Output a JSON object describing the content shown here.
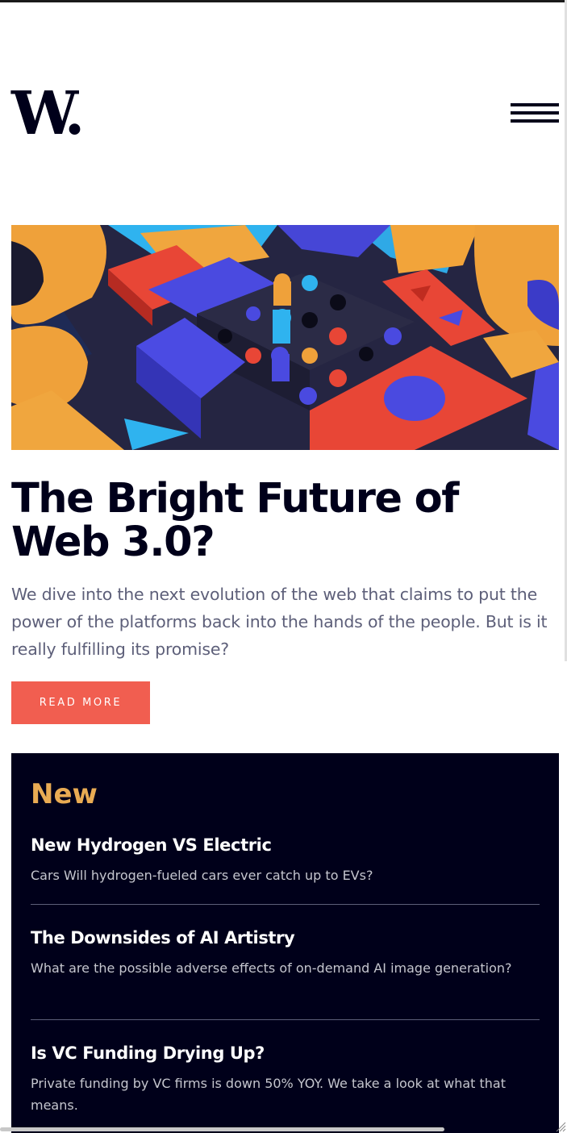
{
  "header": {
    "logo_text": "W.",
    "menu_icon": "hamburger-menu-icon"
  },
  "hero": {
    "image_icon": "abstract-blocks-illustration",
    "title": "The Bright Future of Web 3.0?",
    "description": "We dive into the next evolution of the web that claims to put the power of the platforms back into the hands of the people. But is it really fulfilling its promise?",
    "button_label": "READ MORE"
  },
  "new_section": {
    "heading": "New",
    "items": [
      {
        "title": "New Hydrogen VS Electric",
        "description": "Cars Will hydrogen-fueled cars ever catch up to EVs?"
      },
      {
        "title": "The Downsides of AI Artistry",
        "description": "What are the possible adverse effects of on-demand AI image generation?"
      },
      {
        "title": "Is VC Funding Drying Up?",
        "description": "Private funding by VC firms is down 50% YOY. We take a look at what that means."
      }
    ]
  },
  "colors": {
    "dark_navy": "#00001a",
    "accent_red": "#f15e50",
    "accent_orange": "#e9ab53",
    "grayish_blue": "#5d5f79",
    "light_gray_text": "#c5c6ce"
  }
}
